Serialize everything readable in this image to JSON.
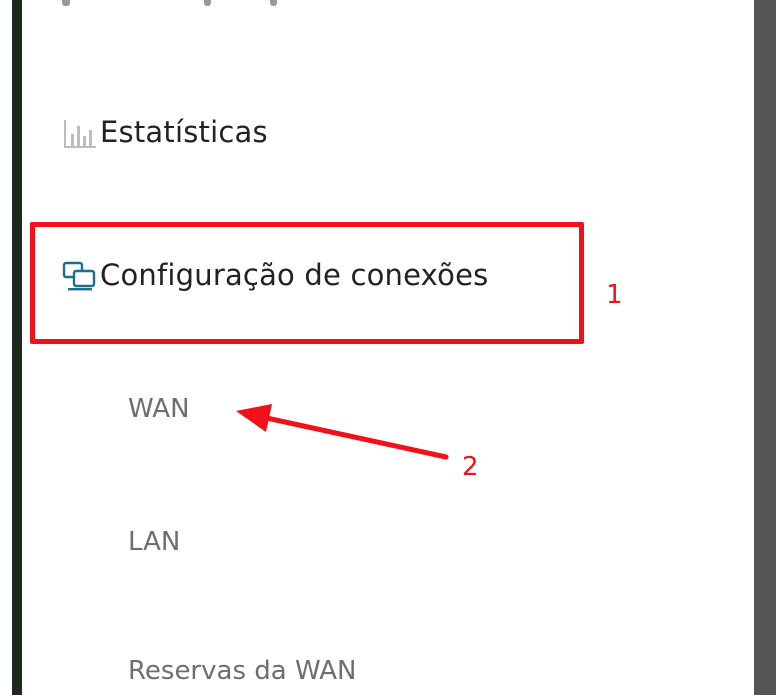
{
  "sidebar": {
    "items": [
      {
        "label": "Estatísticas",
        "icon": "bar-chart-icon"
      },
      {
        "label": "Configuração de conexões",
        "icon": "connections-icon"
      }
    ],
    "sub_items": [
      {
        "label": "WAN"
      },
      {
        "label": "LAN"
      },
      {
        "label": "Reservas da WAN"
      }
    ]
  },
  "annotations": {
    "box_label": "1",
    "arrow_label": "2",
    "color": "#f2101a"
  },
  "colors": {
    "accent": "#1a6f8a",
    "text_dark": "#222222",
    "text_sub": "#6e6e6e"
  }
}
